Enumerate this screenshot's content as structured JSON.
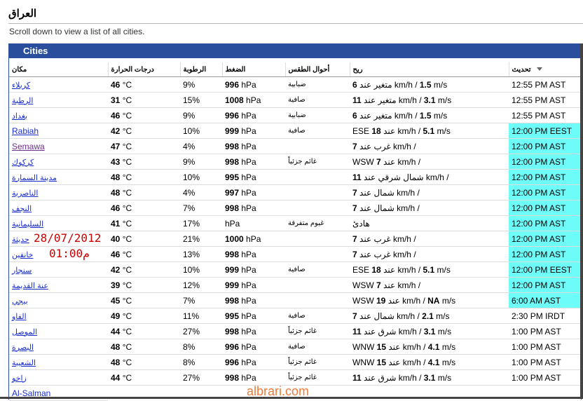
{
  "page": {
    "title": "العراق",
    "subtitle": "Scroll down to view a list of all cities."
  },
  "panel": {
    "heading": "Cities"
  },
  "columns": [
    "مكان",
    "درجات الحرارة",
    "الرطوبة",
    "الضغط",
    "أحوال الطقس",
    "ريح",
    "تحديث"
  ],
  "rows": [
    {
      "city": "كربلاء",
      "temp": "46",
      "temp_unit": "°C",
      "hum": "9%",
      "press": "996",
      "press_unit": "hPa",
      "cond": "ضبابية",
      "wind_pre": "",
      "wind_speed": "6",
      "wind_mid": " متغير عند km/h / ",
      "wind_ms": "1.5",
      "wind_post": " m/s",
      "upd": "12:55 PM AST",
      "cyan": false,
      "en": false,
      "visited": false
    },
    {
      "city": "الرطبة",
      "temp": "31",
      "temp_unit": "°C",
      "hum": "15%",
      "press": "1008",
      "press_unit": "hPa",
      "cond": "صافية",
      "wind_pre": "",
      "wind_speed": "11",
      "wind_mid": " متغير عند km/h / ",
      "wind_ms": "3.1",
      "wind_post": " m/s",
      "upd": "12:55 PM AST",
      "cyan": false,
      "en": false,
      "visited": false
    },
    {
      "city": "بغداد",
      "temp": "46",
      "temp_unit": "°C",
      "hum": "9%",
      "press": "996",
      "press_unit": "hPa",
      "cond": "ضبابية",
      "wind_pre": "",
      "wind_speed": "6",
      "wind_mid": " متغير عند km/h / ",
      "wind_ms": "1.5",
      "wind_post": " m/s",
      "upd": "12:55 PM AST",
      "cyan": false,
      "en": false,
      "visited": false
    },
    {
      "city": "Rabiah",
      "temp": "42",
      "temp_unit": "°C",
      "hum": "10%",
      "press": "999",
      "press_unit": "hPa",
      "cond": "صافية",
      "wind_pre": "ESE ",
      "wind_speed": "18",
      "wind_mid": " عند km/h / ",
      "wind_ms": "5.1",
      "wind_post": " m/s",
      "upd": "12:00 PM EEST",
      "cyan": true,
      "en": true,
      "visited": false
    },
    {
      "city": "Semawa",
      "temp": "47",
      "temp_unit": "°C",
      "hum": "4%",
      "press": "998",
      "press_unit": "hPa",
      "cond": "",
      "wind_pre": "",
      "wind_speed": "7",
      "wind_mid": " غرب عند km/h /",
      "wind_ms": "",
      "wind_post": "",
      "upd": "12:00 PM AST",
      "cyan": true,
      "en": true,
      "visited": true
    },
    {
      "city": "كركوك",
      "temp": "43",
      "temp_unit": "°C",
      "hum": "9%",
      "press": "998",
      "press_unit": "hPa",
      "cond": "غائم جزئياً",
      "wind_pre": "WSW ",
      "wind_speed": "7",
      "wind_mid": " عند km/h /",
      "wind_ms": "",
      "wind_post": "",
      "upd": "12:00 PM AST",
      "cyan": true,
      "en": false,
      "visited": false
    },
    {
      "city": "مدينة السمارة",
      "temp": "48",
      "temp_unit": "°C",
      "hum": "10%",
      "press": "995",
      "press_unit": "hPa",
      "cond": "",
      "wind_pre": "",
      "wind_speed": "11",
      "wind_mid": " شمال شرقي عند km/h /",
      "wind_ms": "",
      "wind_post": "",
      "upd": "12:00 PM AST",
      "cyan": true,
      "en": false,
      "visited": false
    },
    {
      "city": "الناصرية",
      "temp": "48",
      "temp_unit": "°C",
      "hum": "4%",
      "press": "997",
      "press_unit": "hPa",
      "cond": "",
      "wind_pre": "",
      "wind_speed": "7",
      "wind_mid": " شمال عند km/h /",
      "wind_ms": "",
      "wind_post": "",
      "upd": "12:00 PM AST",
      "cyan": true,
      "en": false,
      "visited": false
    },
    {
      "city": "النجف",
      "temp": "46",
      "temp_unit": "°C",
      "hum": "7%",
      "press": "998",
      "press_unit": "hPa",
      "cond": "",
      "wind_pre": "",
      "wind_speed": "7",
      "wind_mid": " شمال عند km/h /",
      "wind_ms": "",
      "wind_post": "",
      "upd": "12:00 PM AST",
      "cyan": true,
      "en": false,
      "visited": false
    },
    {
      "city": "السليمانية",
      "temp": "41",
      "temp_unit": "°C",
      "hum": "17%",
      "press": "",
      "press_unit": "hPa",
      "cond": "غيوم متفرقة",
      "wind_pre": "هادئ",
      "wind_speed": "",
      "wind_mid": "",
      "wind_ms": "",
      "wind_post": "",
      "upd": "12:00 PM AST",
      "cyan": true,
      "en": false,
      "visited": false
    },
    {
      "city": "حديثة",
      "temp": "40",
      "temp_unit": "°C",
      "hum": "21%",
      "press": "1000",
      "press_unit": "hPa",
      "cond": "",
      "wind_pre": "",
      "wind_speed": "7",
      "wind_mid": " غرب عند km/h /",
      "wind_ms": "",
      "wind_post": "",
      "upd": "12:00 PM AST",
      "cyan": true,
      "en": false,
      "visited": false
    },
    {
      "city": "خانقين",
      "temp": "46",
      "temp_unit": "°C",
      "hum": "13%",
      "press": "998",
      "press_unit": "hPa",
      "cond": "",
      "wind_pre": "",
      "wind_speed": "7",
      "wind_mid": " غرب عند km/h /",
      "wind_ms": "",
      "wind_post": "",
      "upd": "12:00 PM AST",
      "cyan": true,
      "en": false,
      "visited": false
    },
    {
      "city": "سنجار",
      "temp": "42",
      "temp_unit": "°C",
      "hum": "10%",
      "press": "999",
      "press_unit": "hPa",
      "cond": "صافية",
      "wind_pre": "ESE ",
      "wind_speed": "18",
      "wind_mid": " عند km/h / ",
      "wind_ms": "5.1",
      "wind_post": " m/s",
      "upd": "12:00 PM EEST",
      "cyan": true,
      "en": false,
      "visited": false
    },
    {
      "city": "عنة القديمة",
      "temp": "39",
      "temp_unit": "°C",
      "hum": "12%",
      "press": "999",
      "press_unit": "hPa",
      "cond": "",
      "wind_pre": "WSW ",
      "wind_speed": "7",
      "wind_mid": " عند km/h /",
      "wind_ms": "",
      "wind_post": "",
      "upd": "12:00 PM AST",
      "cyan": true,
      "en": false,
      "visited": false
    },
    {
      "city": "بيجي",
      "temp": "45",
      "temp_unit": "°C",
      "hum": "7%",
      "press": "998",
      "press_unit": "hPa",
      "cond": "",
      "wind_pre": "WSW ",
      "wind_speed": "19",
      "wind_mid": " عند km/h / ",
      "wind_ms": "NA",
      "wind_post": " m/s",
      "upd": "6:00 AM AST",
      "cyan": true,
      "en": false,
      "visited": false
    },
    {
      "city": "الفاو",
      "temp": "49",
      "temp_unit": "°C",
      "hum": "11%",
      "press": "995",
      "press_unit": "hPa",
      "cond": "صافية",
      "wind_pre": "",
      "wind_speed": "7",
      "wind_mid": " شمال عند km/h / ",
      "wind_ms": "2.1",
      "wind_post": " m/s",
      "upd": "2:30 PM IRDT",
      "cyan": false,
      "en": false,
      "visited": false
    },
    {
      "city": "الموصل",
      "temp": "44",
      "temp_unit": "°C",
      "hum": "27%",
      "press": "998",
      "press_unit": "hPa",
      "cond": "غائم جزئياً",
      "wind_pre": "",
      "wind_speed": "11",
      "wind_mid": " شرق عند km/h / ",
      "wind_ms": "3.1",
      "wind_post": " m/s",
      "upd": "1:00 PM AST",
      "cyan": false,
      "en": false,
      "visited": false
    },
    {
      "city": "البصرة",
      "temp": "48",
      "temp_unit": "°C",
      "hum": "8%",
      "press": "996",
      "press_unit": "hPa",
      "cond": "صافية",
      "wind_pre": "WNW ",
      "wind_speed": "15",
      "wind_mid": " عند km/h / ",
      "wind_ms": "4.1",
      "wind_post": " m/s",
      "upd": "1:00 PM AST",
      "cyan": false,
      "en": false,
      "visited": false
    },
    {
      "city": "الشعيبة",
      "temp": "48",
      "temp_unit": "°C",
      "hum": "8%",
      "press": "996",
      "press_unit": "hPa",
      "cond": "غائم جزئياً",
      "wind_pre": "WNW ",
      "wind_speed": "15",
      "wind_mid": " عند km/h / ",
      "wind_ms": "4.1",
      "wind_post": " m/s",
      "upd": "1:00 PM AST",
      "cyan": false,
      "en": false,
      "visited": false
    },
    {
      "city": "زاخو",
      "temp": "44",
      "temp_unit": "°C",
      "hum": "27%",
      "press": "998",
      "press_unit": "hPa",
      "cond": "غائم جزئياً",
      "wind_pre": "",
      "wind_speed": "11",
      "wind_mid": " شرق عند km/h / ",
      "wind_ms": "3.1",
      "wind_post": " m/s",
      "upd": "1:00 PM AST",
      "cyan": false,
      "en": false,
      "visited": false
    },
    {
      "city": "Al-Salman",
      "temp": "",
      "temp_unit": "",
      "hum": "",
      "press": "",
      "press_unit": "",
      "cond": "",
      "wind_pre": "",
      "wind_speed": "",
      "wind_mid": "",
      "wind_ms": "",
      "wind_post": "",
      "upd": "",
      "cyan": false,
      "en": true,
      "visited": false
    }
  ],
  "overlay": {
    "date": "28/07/2012",
    "time": "01:00م"
  },
  "watermark": "albrari.com",
  "colors": {
    "header_blue": "#2a4e9c",
    "highlight": "#6efcf8",
    "link": "#1a2ecc",
    "overlay_red": "#cc0000",
    "watermark": "#f07a3a"
  },
  "icons": {
    "sort": "sort-desc-icon"
  }
}
